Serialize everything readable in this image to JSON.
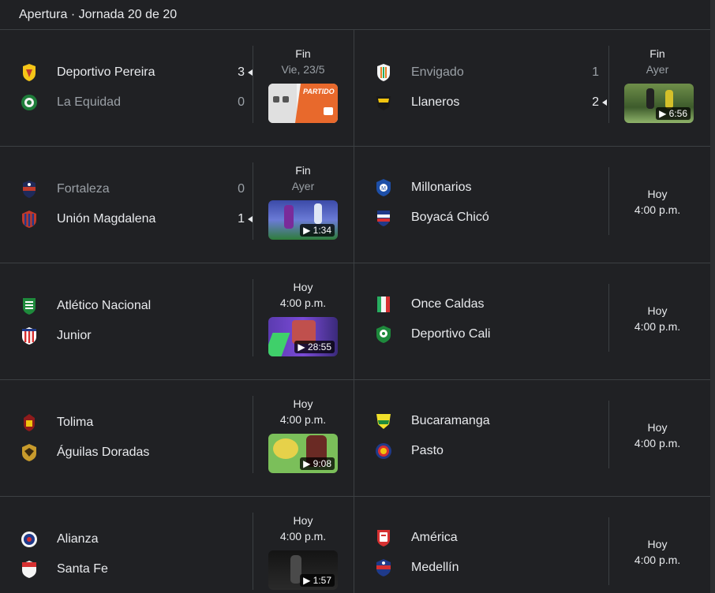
{
  "header": {
    "title": "Apertura · Jornada 20 de 20"
  },
  "rows": [
    {
      "left": {
        "home": {
          "name": "Deportivo Pereira",
          "score": "3",
          "winner": true
        },
        "away": {
          "name": "La Equidad",
          "score": "0",
          "winner": false
        },
        "status1": "Fin",
        "status2": "Vie, 23/5",
        "video": {
          "duration": "",
          "label": "PARTIDO"
        }
      },
      "right": {
        "home": {
          "name": "Envigado",
          "score": "1",
          "winner": false
        },
        "away": {
          "name": "Llaneros",
          "score": "2",
          "winner": true
        },
        "status1": "Fin",
        "status2": "Ayer",
        "video": {
          "duration": "6:56"
        }
      }
    },
    {
      "left": {
        "home": {
          "name": "Fortaleza",
          "score": "0",
          "winner": false
        },
        "away": {
          "name": "Unión Magdalena",
          "score": "1",
          "winner": true
        },
        "status1": "Fin",
        "status2": "Ayer",
        "video": {
          "duration": "1:34"
        }
      },
      "right": {
        "home": {
          "name": "Millonarios"
        },
        "away": {
          "name": "Boyacá Chicó"
        },
        "status1": "Hoy",
        "status2": "4:00 p.m."
      }
    },
    {
      "left": {
        "home": {
          "name": "Atlético Nacional"
        },
        "away": {
          "name": "Junior"
        },
        "status1": "Hoy",
        "status2": "4:00 p.m.",
        "video": {
          "duration": "28:55"
        }
      },
      "right": {
        "home": {
          "name": "Once Caldas"
        },
        "away": {
          "name": "Deportivo Cali"
        },
        "status1": "Hoy",
        "status2": "4:00 p.m."
      }
    },
    {
      "left": {
        "home": {
          "name": "Tolima"
        },
        "away": {
          "name": "Águilas Doradas"
        },
        "status1": "Hoy",
        "status2": "4:00 p.m.",
        "video": {
          "duration": "9:08"
        }
      },
      "right": {
        "home": {
          "name": "Bucaramanga"
        },
        "away": {
          "name": "Pasto"
        },
        "status1": "Hoy",
        "status2": "4:00 p.m."
      }
    },
    {
      "left": {
        "home": {
          "name": "Alianza"
        },
        "away": {
          "name": "Santa Fe"
        },
        "status1": "Hoy",
        "status2": "4:00 p.m.",
        "video": {
          "duration": "1:57"
        }
      },
      "right": {
        "home": {
          "name": "América"
        },
        "away": {
          "name": "Medellín"
        },
        "status1": "Hoy",
        "status2": "4:00 p.m."
      }
    }
  ],
  "colors": {
    "background": "#202124",
    "divider": "#3c4043",
    "text": "#e8eaed",
    "muted": "#9aa0a6"
  }
}
